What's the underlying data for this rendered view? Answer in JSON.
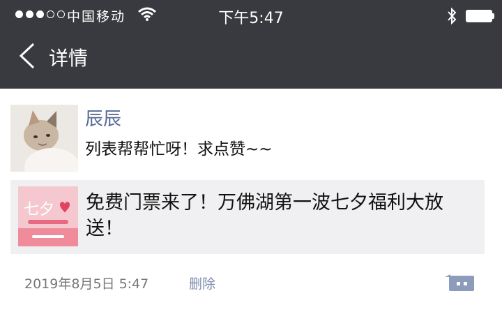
{
  "status_bar": {
    "carrier": "中国移动",
    "time": "下午5:47",
    "signal_strength": "3 of 5",
    "icons": [
      "signal-dots-icon",
      "wifi-icon",
      "bluetooth-icon",
      "battery-icon"
    ]
  },
  "nav": {
    "title": "详情",
    "back_icon": "chevron-left-icon"
  },
  "post": {
    "user_name": "辰辰",
    "text": "列表帮帮忙呀！求点赞~~",
    "link_title": "免费门票来了！万佛湖第一波七夕福利大放送！",
    "timestamp": "2019年8月5日  5:47",
    "delete_label": "删除",
    "comment_icon": "comment-more-icon"
  },
  "colors": {
    "header_bg": "#393a3f",
    "name_link": "#576b95",
    "delete_link": "#7d8bac",
    "card_bg": "#f0f0f2"
  }
}
